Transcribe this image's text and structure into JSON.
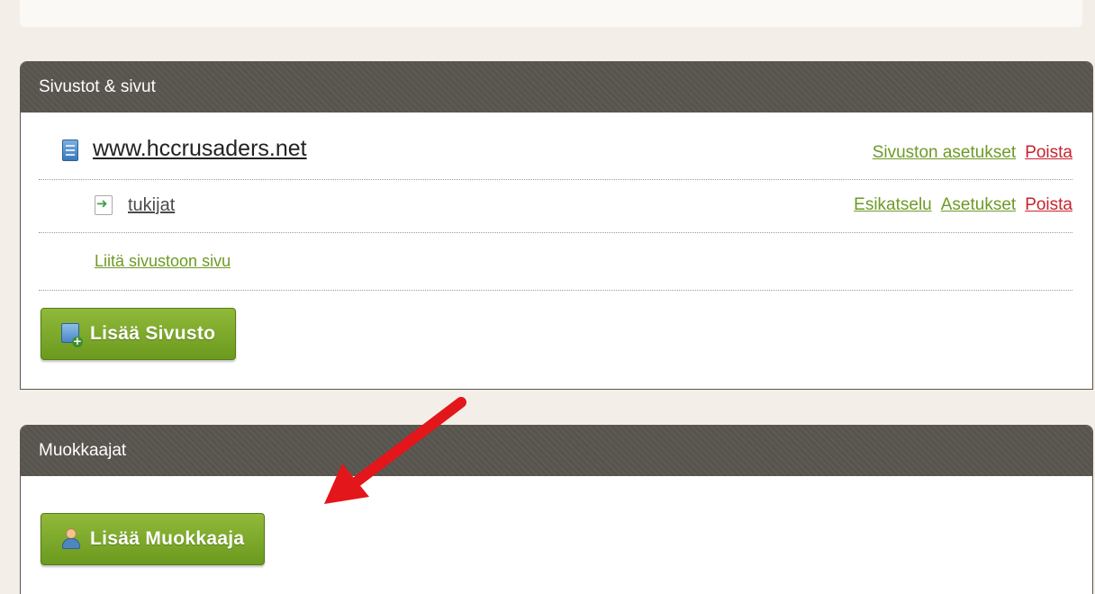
{
  "sites_panel": {
    "title": "Sivustot & sivut",
    "site": {
      "name": "www.hccrusaders.net",
      "settings_label": "Sivuston asetukset",
      "delete_label": "Poista"
    },
    "page": {
      "name": "tukijat",
      "preview_label": "Esikatselu",
      "settings_label": "Asetukset",
      "delete_label": "Poista"
    },
    "attach_page_label": "Liitä sivustoon sivu",
    "add_site_label": "Lisää Sivusto"
  },
  "editors_panel": {
    "title": "Muokkaajat",
    "add_editor_label": "Lisää Muokkaaja"
  },
  "icons": {
    "site": "site-book-icon",
    "page": "page-arrow-icon",
    "add_site": "add-site-icon",
    "add_user": "add-user-icon",
    "annotation": "red-arrow-icon"
  },
  "colors": {
    "header_bg": "#57534d",
    "accent_green": "#6e9a26",
    "danger_red": "#c8222e",
    "button_green": "#7aa62a",
    "arrow_red": "#e3161b"
  }
}
